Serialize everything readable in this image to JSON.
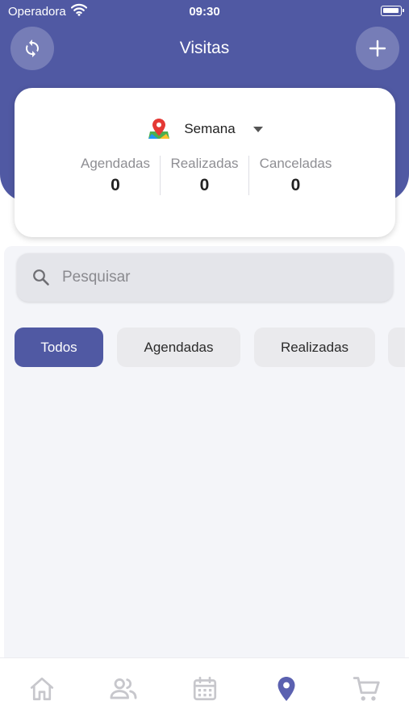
{
  "status_bar": {
    "carrier": "Operadora",
    "time": "09:30"
  },
  "header": {
    "title": "Visitas",
    "refresh_icon": "refresh-icon",
    "add_icon": "plus-icon",
    "background_color": "#5059a3"
  },
  "summary": {
    "period_icon": "map-pin-icon",
    "period_label": "Semana",
    "stats": [
      {
        "label": "Agendadas",
        "value": "0"
      },
      {
        "label": "Realizadas",
        "value": "0"
      },
      {
        "label": "Canceladas",
        "value": "0"
      }
    ]
  },
  "search": {
    "placeholder": "Pesquisar",
    "value": ""
  },
  "filters": [
    {
      "label": "Todos",
      "active": true
    },
    {
      "label": "Agendadas",
      "active": false
    },
    {
      "label": "Realizadas",
      "active": false
    },
    {
      "label": "",
      "active": false
    }
  ],
  "bottom_nav": [
    {
      "icon": "home-icon",
      "active": false
    },
    {
      "icon": "people-icon",
      "active": false
    },
    {
      "icon": "calendar-icon",
      "active": false
    },
    {
      "icon": "location-pin-icon",
      "active": true
    },
    {
      "icon": "cart-icon",
      "active": false
    }
  ],
  "colors": {
    "accent": "#5059a3",
    "active_nav": "#5b61b0",
    "inactive_nav": "#c7c7cc"
  }
}
